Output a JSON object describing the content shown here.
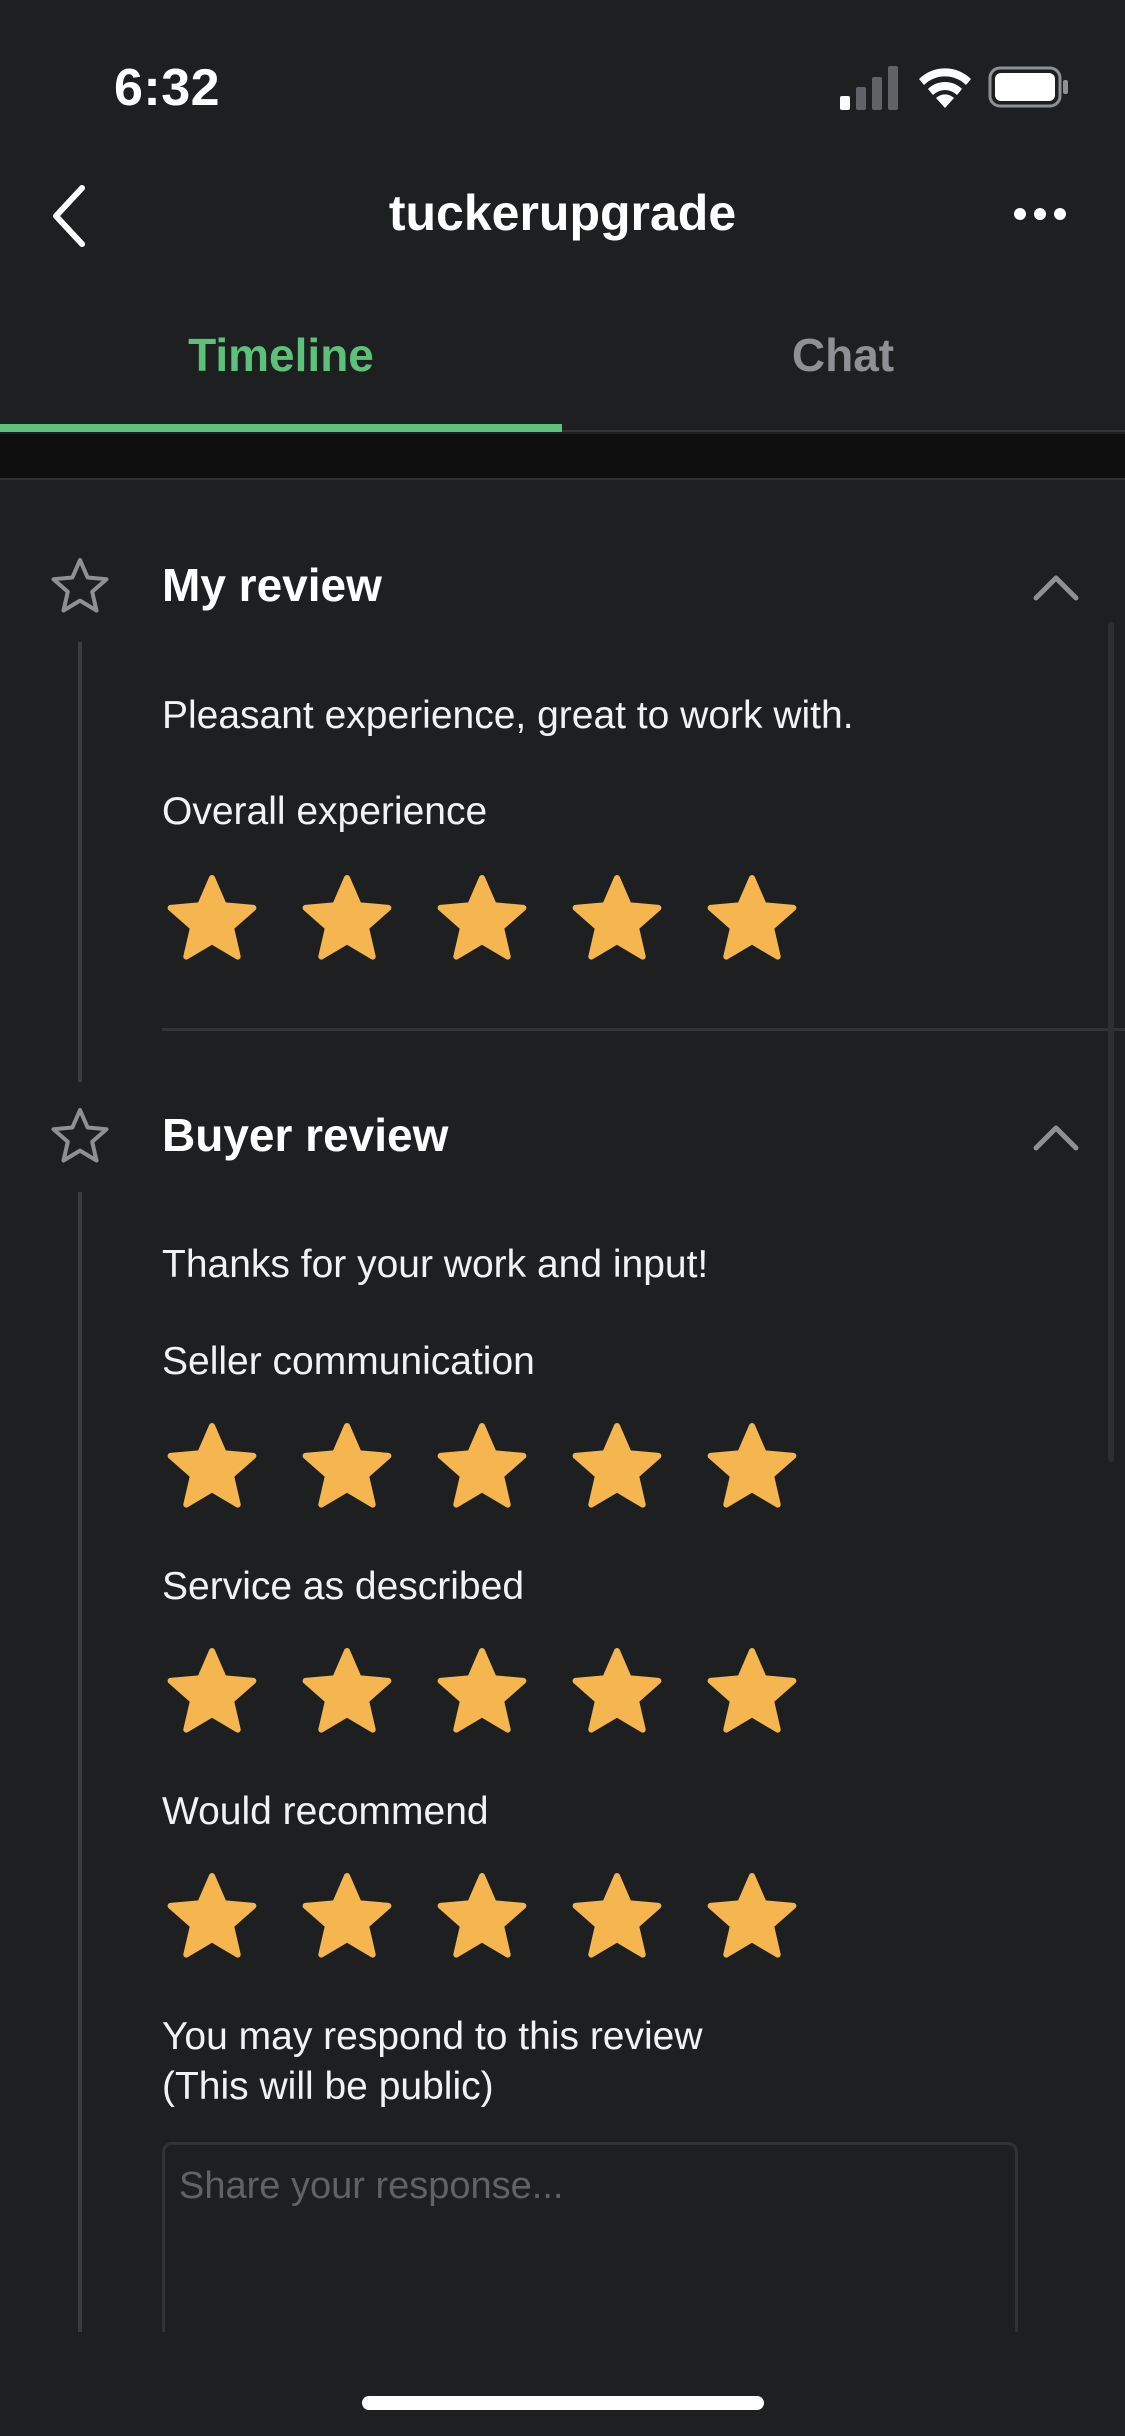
{
  "status_bar": {
    "time": "6:32",
    "signal_icon": "cellular-signal-icon",
    "wifi_icon": "wifi-icon",
    "battery_icon": "battery-icon"
  },
  "header": {
    "title": "tuckerupgrade",
    "back_icon": "chevron-left-icon",
    "more_icon": "ellipsis-icon"
  },
  "tabs": [
    {
      "label": "Timeline",
      "active": true
    },
    {
      "label": "Chat",
      "active": false
    }
  ],
  "colors": {
    "accent": "#5cc27a",
    "star": "#f5b54f",
    "background": "#1e1f21",
    "muted_text": "#8d9095"
  },
  "my_review": {
    "title": "My review",
    "comment": "Pleasant experience, great to work with.",
    "ratings": [
      {
        "label": "Overall experience",
        "stars": 5,
        "max": 5
      }
    ]
  },
  "buyer_review": {
    "title": "Buyer review",
    "comment": "Thanks for your work and input!",
    "ratings": [
      {
        "label": "Seller communication",
        "stars": 5,
        "max": 5
      },
      {
        "label": "Service as described",
        "stars": 5,
        "max": 5
      },
      {
        "label": "Would recommend",
        "stars": 5,
        "max": 5
      }
    ],
    "respond_prompt_line1": "You may respond to this review",
    "respond_prompt_line2": "(This will be public)",
    "response_placeholder": "Share your response..."
  }
}
